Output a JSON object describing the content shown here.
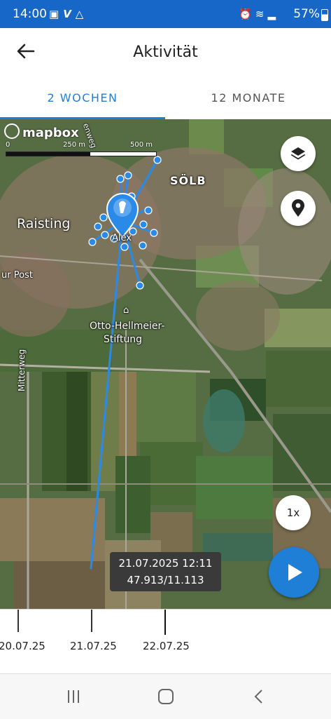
{
  "status_bar": {
    "time": "14:00",
    "left_icons": [
      "image-icon",
      "v-icon",
      "drive-icon"
    ],
    "right_icons": [
      "alarm-icon",
      "wifi-icon",
      "signal-icon"
    ],
    "battery": "57%"
  },
  "header": {
    "title": "Aktivität",
    "back_icon": "arrow-left-icon"
  },
  "tabs": [
    {
      "label": "2 WOCHEN",
      "active": true
    },
    {
      "label": "12 MONATE",
      "active": false
    }
  ],
  "map": {
    "attribution": "mapbox",
    "scale_labels": [
      "0",
      "250 m",
      "500 m"
    ],
    "place_labels": [
      "SÖLB",
      "Raisting",
      "ur Post",
      "Otto-Hellmeier-",
      "Stiftung",
      "Mitterweg",
      "enweg"
    ],
    "track_marker_label": "Alex",
    "controls": {
      "layers_icon": "layers-icon",
      "location_icon": "location-pin-icon",
      "speed_label": "1x",
      "play_icon": "play-icon"
    },
    "tooltip": {
      "datetime": "21.07.2025 12:11",
      "coords": "47.913/11.113"
    },
    "accent_color": "#1f7fd6"
  },
  "timeline": {
    "labels": [
      "20.07.25",
      "21.07.25",
      "22.07.25"
    ]
  },
  "navbar": {
    "icons": [
      "recent-apps-icon",
      "home-icon",
      "back-icon"
    ]
  }
}
